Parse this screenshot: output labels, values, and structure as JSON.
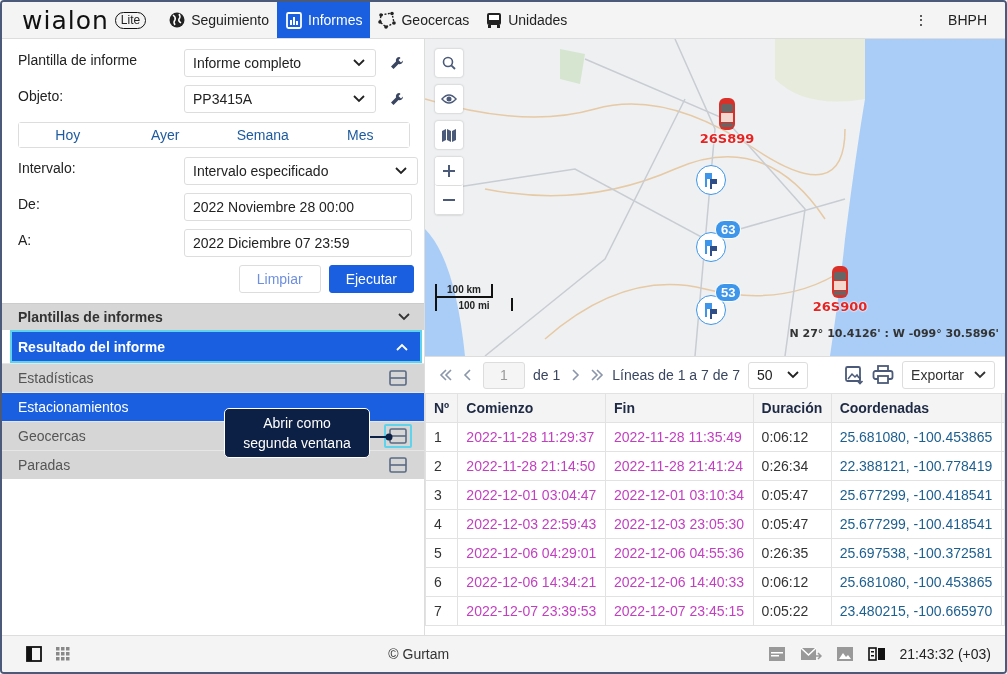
{
  "header": {
    "logo": "wialon",
    "edition": "Lite",
    "tabs": [
      {
        "label": "Seguimiento",
        "selected": false
      },
      {
        "label": "Informes",
        "selected": true
      },
      {
        "label": "Geocercas",
        "selected": false
      },
      {
        "label": "Unidades",
        "selected": false
      }
    ],
    "menu": "⋮",
    "user": "BHPH"
  },
  "form": {
    "rows": [
      {
        "kind": "select",
        "label": "Plantilla de informe",
        "value": "Informe completo",
        "tool": true
      },
      {
        "kind": "select",
        "label": "Objeto:",
        "value": "PP3415A",
        "tool": true
      },
      {
        "kind": "periods",
        "periods": [
          {
            "label": "Hoy",
            "selected": false
          },
          {
            "label": "Ayer",
            "selected": false
          },
          {
            "label": "Semana",
            "selected": false
          },
          {
            "label": "Mes",
            "selected": false
          }
        ]
      },
      {
        "kind": "select",
        "label": "Intervalo:",
        "value": "Intervalo especificado",
        "tool": false
      },
      {
        "kind": "input",
        "label": "De:",
        "value": "2022 Noviembre 28 00:00"
      },
      {
        "kind": "input",
        "label": "A:",
        "value": "2022 Diciembre 07 23:59"
      }
    ],
    "buttons": [
      {
        "label": "Limpiar",
        "primary": false
      },
      {
        "label": "Ejecutar",
        "primary": true
      }
    ]
  },
  "sections": [
    {
      "title": "Plantillas de informes",
      "expanded": false
    },
    {
      "title": "Resultado del informe",
      "expanded": true
    }
  ],
  "result_items": [
    {
      "label": "Estadísticas",
      "selected": false,
      "hovered": false
    },
    {
      "label": "Estacionamientos",
      "selected": true,
      "hovered": false
    },
    {
      "label": "Geocercas",
      "selected": false,
      "hovered": true
    },
    {
      "label": "Paradas",
      "selected": false,
      "hovered": false
    }
  ],
  "tooltip": "Abrir como segunda ventana",
  "map": {
    "kind": "picture",
    "units": [
      {
        "label": "26S899"
      },
      {
        "label": "26S900"
      }
    ],
    "clusters": [
      {
        "count": "63"
      },
      {
        "count": "53"
      }
    ],
    "scale": [
      "100 km",
      "100 mi"
    ],
    "coordinates": "N 27° 10.4126' : W -099° 30.5896'"
  },
  "pager": {
    "page": "1",
    "of": "de 1",
    "lines": "Líneas de 1 a 7 de 7",
    "per_page": "50",
    "export": "Exportar"
  },
  "table": {
    "columns": [
      "Nº",
      "Comienzo",
      "Fin",
      "Duración",
      "Coordenadas"
    ],
    "rows": [
      [
        "1",
        "2022-11-28 11:29:37",
        "2022-11-28 11:35:49",
        "0:06:12",
        "25.681080, -100.453865"
      ],
      [
        "2",
        "2022-11-28 21:14:50",
        "2022-11-28 21:41:24",
        "0:26:34",
        "22.388121, -100.778419"
      ],
      [
        "3",
        "2022-12-01 03:04:47",
        "2022-12-01 03:10:34",
        "0:05:47",
        "25.677299, -100.418541"
      ],
      [
        "4",
        "2022-12-03 22:59:43",
        "2022-12-03 23:05:30",
        "0:05:47",
        "25.677299, -100.418541"
      ],
      [
        "5",
        "2022-12-06 04:29:01",
        "2022-12-06 04:55:36",
        "0:26:35",
        "25.697538, -100.372581"
      ],
      [
        "6",
        "2022-12-06 14:34:21",
        "2022-12-06 14:40:33",
        "0:06:12",
        "25.681080, -100.453865"
      ],
      [
        "7",
        "2022-12-07 23:39:53",
        "2022-12-07 23:45:15",
        "0:05:22",
        "23.480215, -100.665970"
      ]
    ]
  },
  "footer": {
    "copyright": "© Gurtam",
    "time": "21:43:32 (+03)"
  }
}
